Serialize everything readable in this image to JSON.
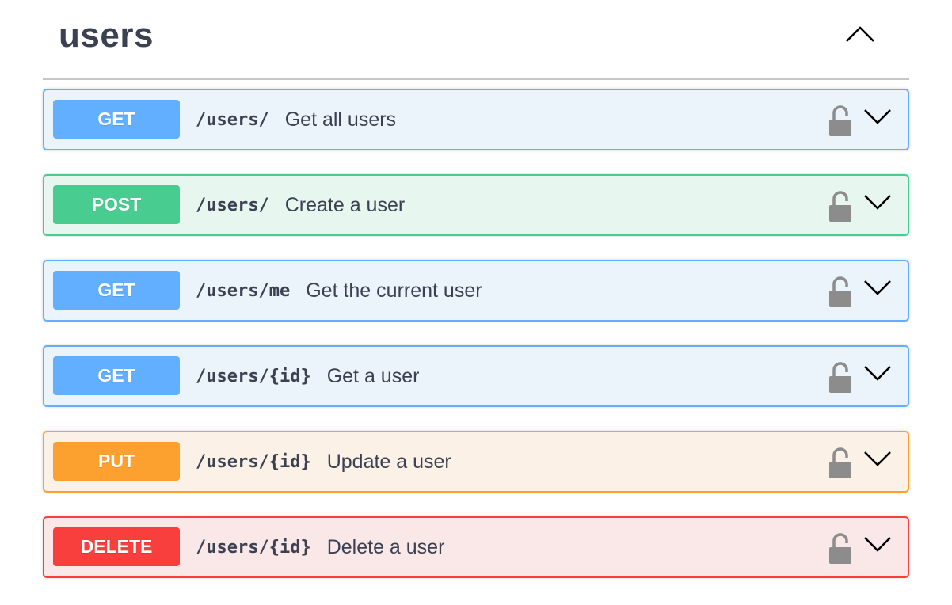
{
  "tag": {
    "title": "users",
    "toggle_icon": "chevron-up-icon"
  },
  "operations": [
    {
      "method": "GET",
      "path": "/users/",
      "summary": "Get all users",
      "lock_icon": "lock-open-icon",
      "expand_icon": "chevron-down-icon"
    },
    {
      "method": "POST",
      "path": "/users/",
      "summary": "Create a user",
      "lock_icon": "lock-open-icon",
      "expand_icon": "chevron-down-icon"
    },
    {
      "method": "GET",
      "path": "/users/me",
      "summary": "Get the current user",
      "lock_icon": "lock-open-icon",
      "expand_icon": "chevron-down-icon"
    },
    {
      "method": "GET",
      "path": "/users/{id}",
      "summary": "Get a user",
      "lock_icon": "lock-open-icon",
      "expand_icon": "chevron-down-icon"
    },
    {
      "method": "PUT",
      "path": "/users/{id}",
      "summary": "Update a user",
      "lock_icon": "lock-open-icon",
      "expand_icon": "chevron-down-icon"
    },
    {
      "method": "DELETE",
      "path": "/users/{id}",
      "summary": "Delete a user",
      "lock_icon": "lock-open-icon",
      "expand_icon": "chevron-down-icon"
    }
  ],
  "colors": {
    "get": "#61affe",
    "post": "#49cc90",
    "put": "#fca130",
    "delete": "#f93e3e",
    "text": "#3b4151",
    "lock": "#8c8c8c"
  }
}
